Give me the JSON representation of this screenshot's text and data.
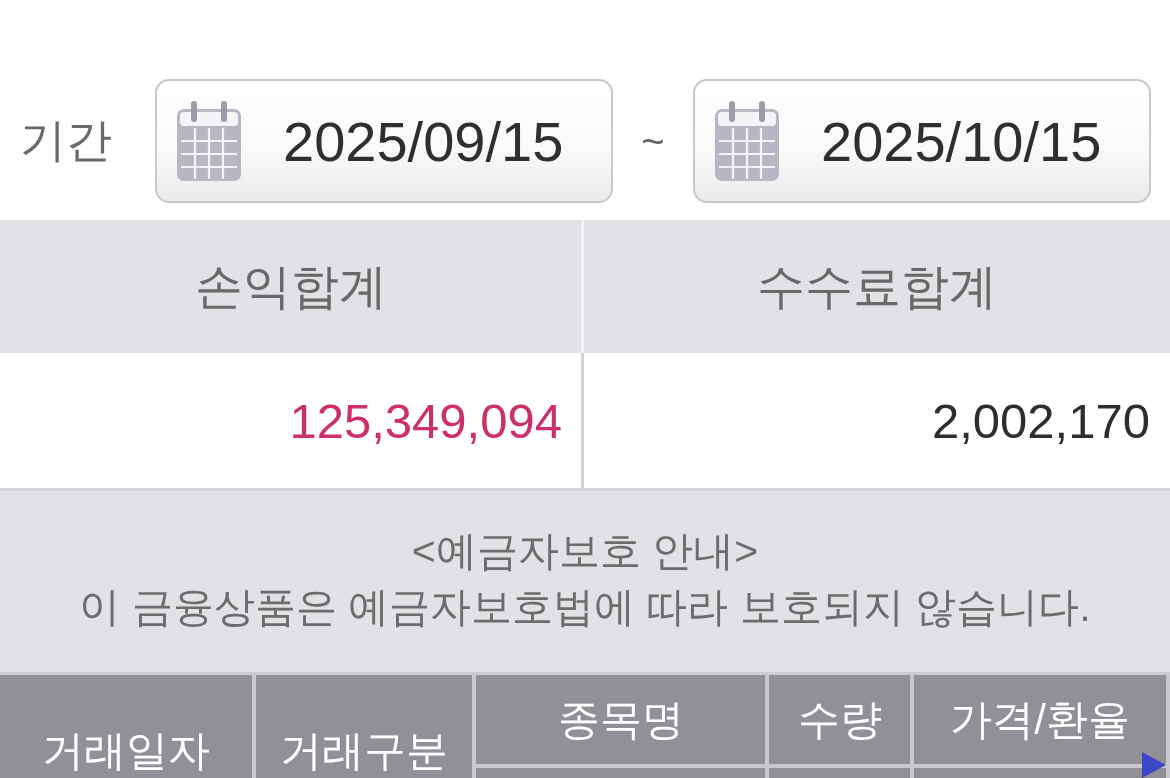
{
  "period": {
    "label": "기간",
    "start_date": "2025/09/15",
    "separator": "~",
    "end_date": "2025/10/15"
  },
  "summary": [
    {
      "label": "손익합계",
      "value": "125,349,094",
      "kind": "gain"
    },
    {
      "label": "수수료합계",
      "value": "2,002,170",
      "kind": "plain"
    }
  ],
  "notice": {
    "title": "<예금자보호 안내>",
    "text": "이 금융상품은 예금자보호법에 따라 보호되지 않습니다."
  },
  "table": {
    "columns": [
      {
        "label": "거래일자",
        "kind": "span"
      },
      {
        "label": "거래구분",
        "kind": "span"
      },
      {
        "label": "종목명",
        "kind": "split"
      },
      {
        "label": "수량",
        "kind": "split"
      },
      {
        "label": "가격/환율",
        "kind": "split"
      }
    ]
  }
}
